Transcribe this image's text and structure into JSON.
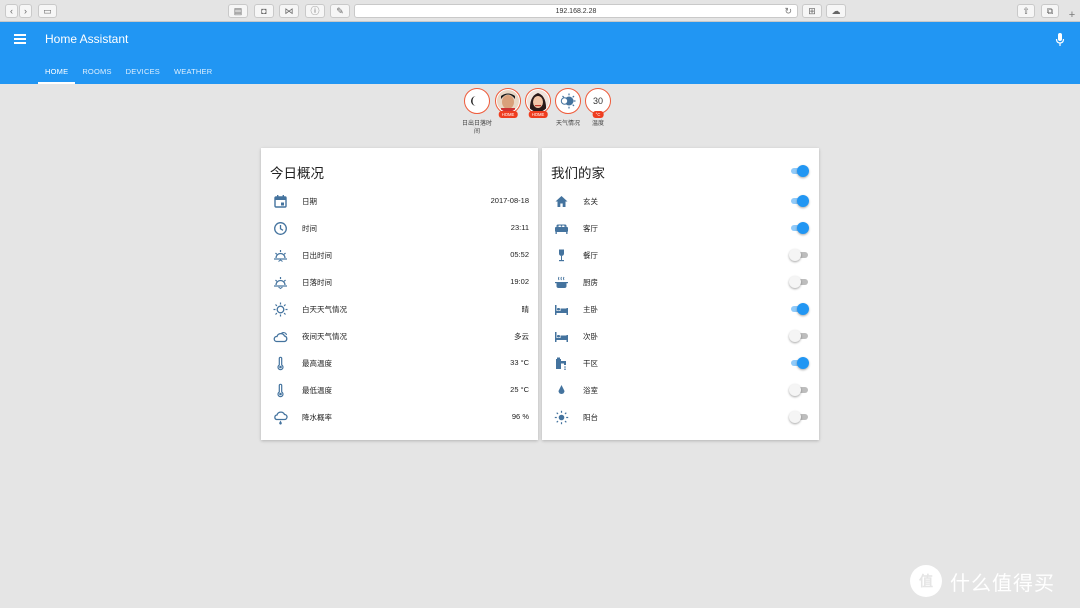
{
  "browser": {
    "url": "192.168.2.28"
  },
  "header": {
    "title": "Home Assistant",
    "tabs": [
      {
        "label": "HOME",
        "active": true
      },
      {
        "label": "ROOMS",
        "active": false
      },
      {
        "label": "DEVICES",
        "active": false
      },
      {
        "label": "WEATHER",
        "active": false
      }
    ]
  },
  "badges": [
    {
      "icon": "moon-icon",
      "label": "日出日落时间",
      "tag": ""
    },
    {
      "icon": "person-male-avatar",
      "label": "",
      "tag": "HOME"
    },
    {
      "icon": "person-female-avatar",
      "label": "",
      "tag": "HOME"
    },
    {
      "icon": "weather-partly-icon",
      "label": "天气情况",
      "tag": ""
    },
    {
      "icon": "",
      "value": "30",
      "label": "温度",
      "tag": "°C"
    }
  ],
  "left_card": {
    "title": "今日概况",
    "rows": [
      {
        "icon": "calendar-icon",
        "label": "日期",
        "value": "2017-08-18"
      },
      {
        "icon": "clock-icon",
        "label": "时间",
        "value": "23:11"
      },
      {
        "icon": "sunrise-icon",
        "label": "日出时间",
        "value": "05:52"
      },
      {
        "icon": "sunset-icon",
        "label": "日落时间",
        "value": "19:02"
      },
      {
        "icon": "sunny-icon",
        "label": "白天天气情况",
        "value": "晴"
      },
      {
        "icon": "cloudy-icon",
        "label": "夜间天气情况",
        "value": "多云"
      },
      {
        "icon": "thermometer-icon",
        "label": "最高温度",
        "value": "33 °C"
      },
      {
        "icon": "thermometer-icon",
        "label": "最低温度",
        "value": "25 °C"
      },
      {
        "icon": "rain-cloud-icon",
        "label": "降水概率",
        "value": "96 %"
      }
    ]
  },
  "right_card": {
    "title": "我们的家",
    "master_on": true,
    "rows": [
      {
        "icon": "home-icon",
        "label": "玄关",
        "on": true
      },
      {
        "icon": "sofa-icon",
        "label": "客厅",
        "on": true
      },
      {
        "icon": "wine-glass-icon",
        "label": "餐厅",
        "on": false
      },
      {
        "icon": "pot-icon",
        "label": "厨房",
        "on": false
      },
      {
        "icon": "bed-icon",
        "label": "主卧",
        "on": true
      },
      {
        "icon": "bed-icon",
        "label": "次卧",
        "on": false
      },
      {
        "icon": "faucet-icon",
        "label": "干区",
        "on": true
      },
      {
        "icon": "water-drop-icon",
        "label": "浴室",
        "on": false
      },
      {
        "icon": "sun-icon",
        "label": "阳台",
        "on": false
      }
    ]
  },
  "watermark": {
    "logo": "值",
    "text": "什么值得买"
  },
  "colors": {
    "primary": "#2196f3",
    "icon": "#44739e",
    "badge_accent": "#ef5b3a",
    "background": "#e5e5e5"
  }
}
